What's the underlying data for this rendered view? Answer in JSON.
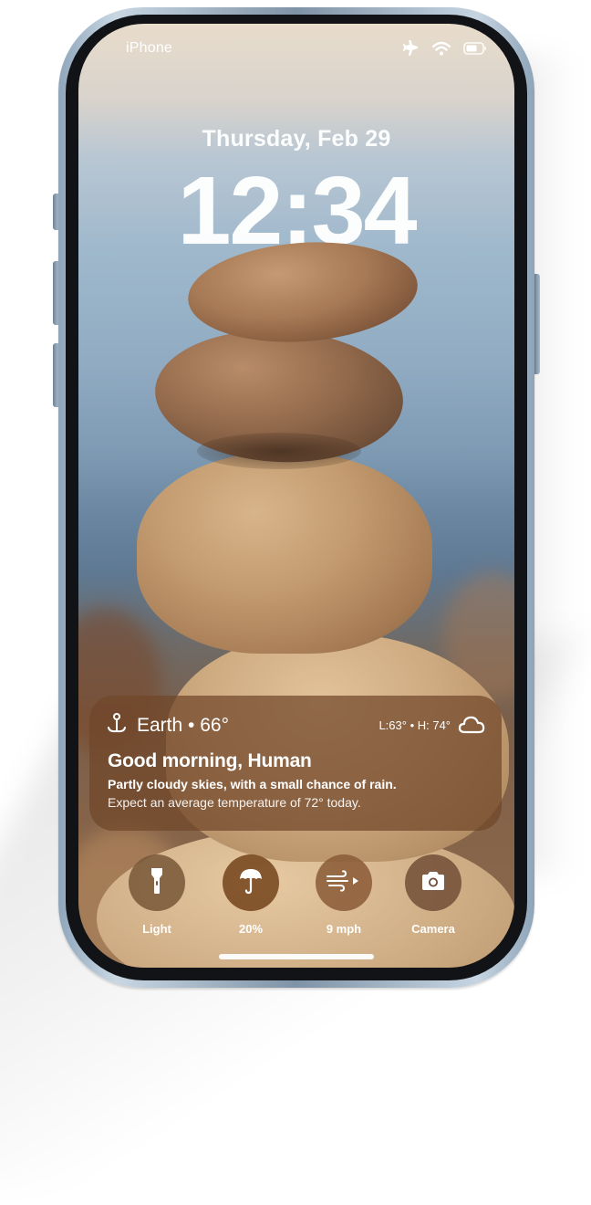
{
  "status_bar": {
    "carrier": "iPhone",
    "icons": [
      "airplane-icon",
      "wifi-icon",
      "battery-icon"
    ]
  },
  "lock_screen": {
    "date": "Thursday, Feb 29",
    "time": "12:34"
  },
  "weather_widget": {
    "location_icon": "location-pin-icon",
    "location": "Earth • 66°",
    "range": "L:63° • H: 74°",
    "condition_icon": "cloud-icon",
    "greeting": "Good morning, Human",
    "summary": "Partly cloudy skies, with a small chance of rain.",
    "detail": "Expect an average temperature of 72° today."
  },
  "controls": [
    {
      "icon": "flashlight-icon",
      "label": "Light"
    },
    {
      "icon": "umbrella-icon",
      "label": "20%"
    },
    {
      "icon": "wind-icon",
      "label": "9 mph"
    },
    {
      "icon": "camera-icon",
      "label": "Camera"
    }
  ],
  "colors": {
    "widget_bg": "#70462A",
    "control_light": "#7A5A3A",
    "control_umbrella": "#7A4A22",
    "control_wind": "#8A5A36",
    "control_camera": "#6E4A33"
  }
}
